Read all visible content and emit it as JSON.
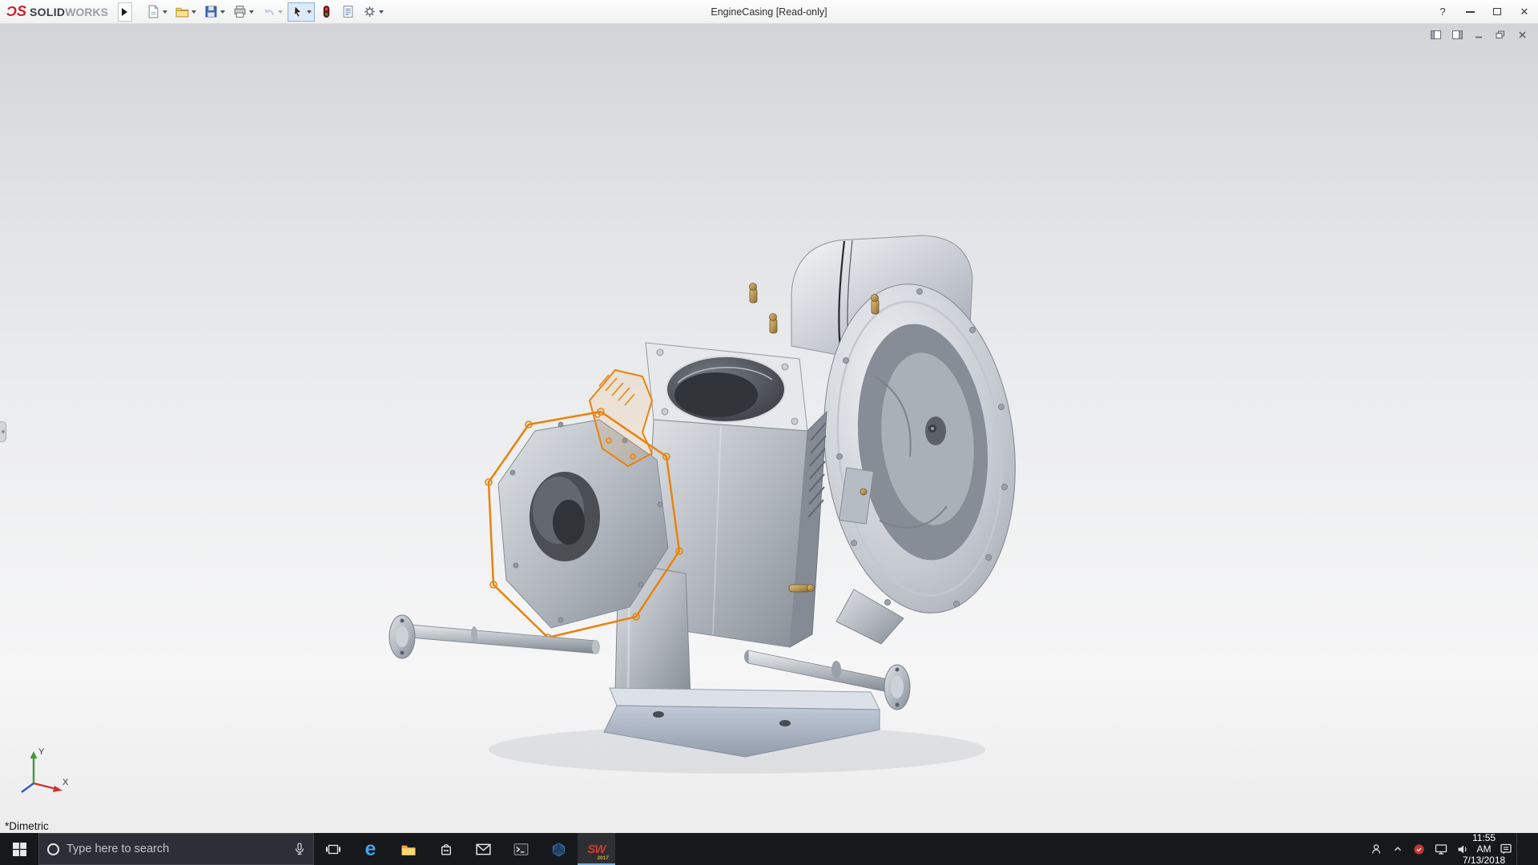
{
  "titlebar": {
    "logo_ds": "ϽS",
    "logo_solid": "SOLID",
    "logo_works": "WORKS",
    "doc_title": "EngineCasing [Read-only]",
    "help_glyph": "?",
    "close_glyph": "✕"
  },
  "toolbar": {
    "icons": [
      "new-document",
      "open",
      "save",
      "print",
      "undo",
      "select",
      "rebuild",
      "file-properties",
      "options"
    ]
  },
  "viewport": {
    "orientation": "*Dimetric",
    "axis_x": "X",
    "axis_y": "Y",
    "selected_component": "front cover highlighted orange"
  },
  "child_window_icons": [
    "display-pane-left",
    "display-pane-right",
    "minimize",
    "restore",
    "close"
  ],
  "taskbar": {
    "search_placeholder": "Type here to search",
    "edge_glyph": "e",
    "sw_label": "SW",
    "sw_year": "2017",
    "clock_time": "11:55 AM",
    "clock_date": "7/13/2018",
    "tray_icons": [
      "people",
      "show-hidden-icons",
      "security",
      "network",
      "volume",
      "action-center"
    ]
  },
  "colors": {
    "selection_highlight": "#e8830d",
    "taskbar_background": "#16181c",
    "titlebar_background": "#f4f5f6",
    "logo_red": "#d21f2c",
    "edge_blue": "#45a3e6",
    "active_app_underline": "#6fb2e8"
  }
}
